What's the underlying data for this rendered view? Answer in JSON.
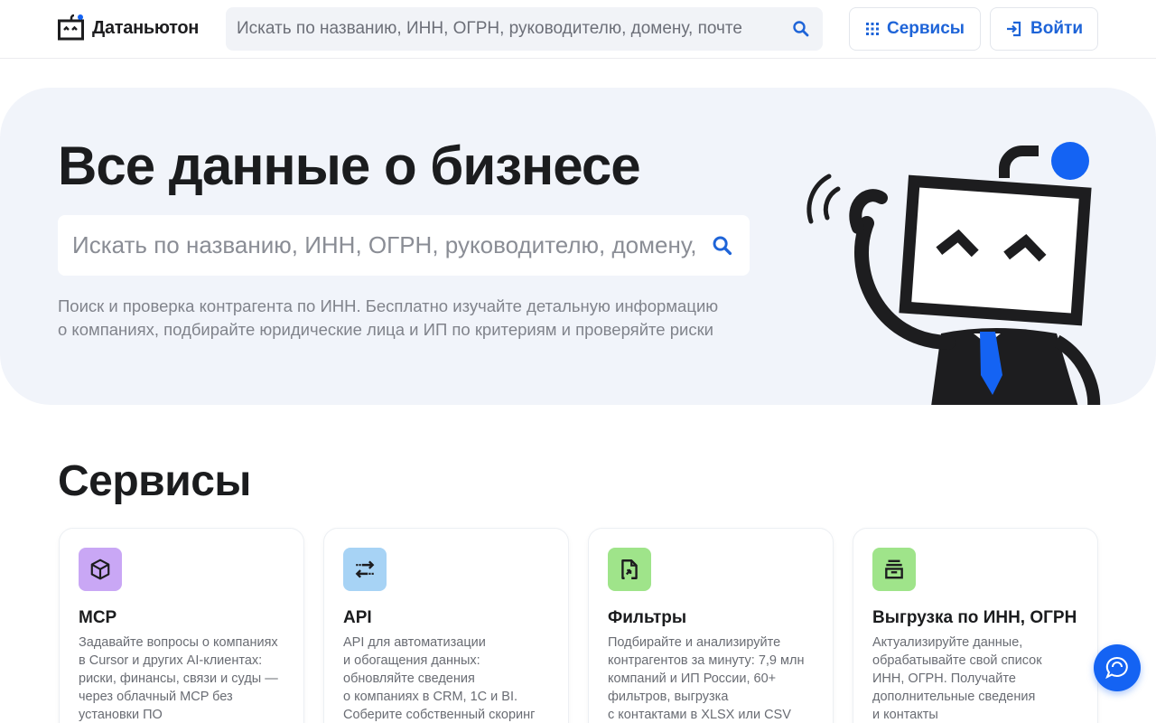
{
  "header": {
    "brand": "Датаньютон",
    "search_placeholder": "Искать по названию, ИНН, ОГРН, руководителю, домену, почте",
    "services_label": "Сервисы",
    "login_label": "Войти"
  },
  "hero": {
    "title": "Все данные о бизнесе",
    "search_placeholder": "Искать по названию, ИНН, ОГРН, руководителю, домену, почте",
    "description": "Поиск и проверка контрагента по ИНН. Бесплатно изучайте детальную информацию о компаниях, подбирайте юридические лица и ИП по критериям и проверяйте риски"
  },
  "services": {
    "title": "Сервисы",
    "cards": [
      {
        "title": "MCP",
        "icon": "cube-icon",
        "icon_bg": "#c9a7f5",
        "description": "Задавайте вопросы о компаниях\nв Cursor и других AI-клиентах:\nриски, финансы, связи и суды —\nчерез облачный MCP без\nустановки ПО"
      },
      {
        "title": "API",
        "icon": "arrows-exchange-icon",
        "icon_bg": "#a7d3f5",
        "description": "API для автоматизации\nи обогащения данных:\nобновляйте сведения\nо компаниях в CRM, 1С и BI.\nСоберите собственный скоринг"
      },
      {
        "title": "Фильтры",
        "icon": "document-arrow-icon",
        "icon_bg": "#9fe48a",
        "description": "Подбирайте и анализируйте\nконтрагентов за минуту: 7,9 млн\nкомпаний и ИП России, 60+\nфильтров, выгрузка\nс контактами в XLSX или CSV"
      },
      {
        "title": "Выгрузка по ИНН, ОГРН",
        "icon": "inbox-tray-icon",
        "icon_bg": "#9fe48a",
        "description": "Актуализируйте данные,\nобрабатывайте свой список\nИНН, ОГРН. Получайте\nдополнительные сведения\nи контакты"
      }
    ]
  },
  "colors": {
    "accent": "#1e64d8",
    "hero_bg": "#f1f4fa",
    "robot_accent": "#1463f3"
  }
}
